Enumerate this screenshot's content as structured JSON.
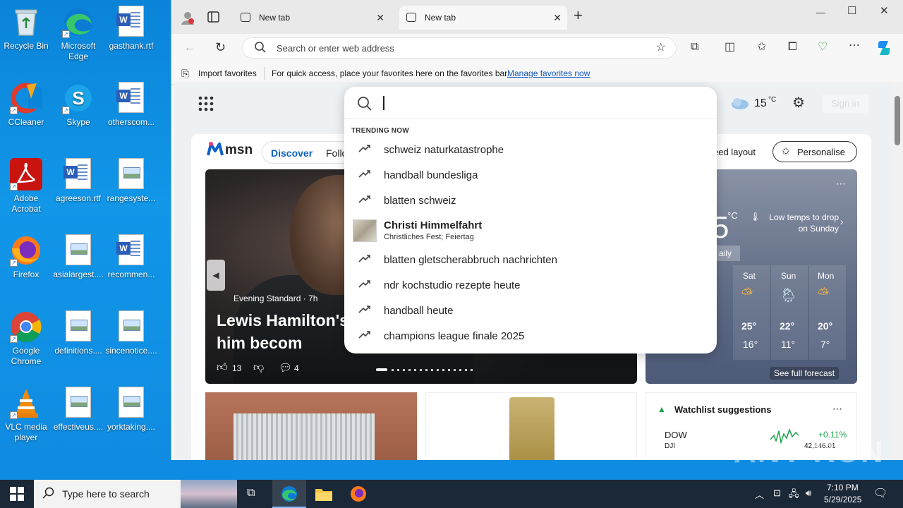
{
  "desktop": {
    "icons": [
      {
        "label": "Recycle Bin",
        "icon": "recycle-bin-icon"
      },
      {
        "label": "Microsoft Edge",
        "icon": "edge-icon"
      },
      {
        "label": "gasthank.rtf",
        "icon": "word-doc-icon"
      },
      {
        "label": "CCleaner",
        "icon": "ccleaner-icon"
      },
      {
        "label": "Skype",
        "icon": "skype-icon"
      },
      {
        "label": "otherscom...",
        "icon": "word-doc-icon"
      },
      {
        "label": "Adobe Acrobat",
        "icon": "acrobat-icon"
      },
      {
        "label": "agreeson.rtf",
        "icon": "word-doc-icon"
      },
      {
        "label": "rangesyste...",
        "icon": "image-file-icon"
      },
      {
        "label": "Firefox",
        "icon": "firefox-icon"
      },
      {
        "label": "asialargest....",
        "icon": "image-file-icon"
      },
      {
        "label": "recommen...",
        "icon": "word-doc-icon"
      },
      {
        "label": "Google Chrome",
        "icon": "chrome-icon"
      },
      {
        "label": "definitions....",
        "icon": "image-file-icon"
      },
      {
        "label": "sincenotice....",
        "icon": "image-file-icon"
      },
      {
        "label": "VLC media player",
        "icon": "vlc-icon"
      },
      {
        "label": "effectiveus....",
        "icon": "image-file-icon"
      },
      {
        "label": "yorktaking....",
        "icon": "image-file-icon"
      }
    ]
  },
  "browser": {
    "tabs": [
      {
        "label": "New tab",
        "close": "✕"
      },
      {
        "label": "New tab",
        "close": "✕"
      }
    ],
    "new_tab": "+",
    "window_controls": {
      "minimize": "—",
      "maximize": "☐",
      "close": "✕"
    },
    "address_placeholder": "Search or enter web address",
    "favorites_bar": {
      "import": "Import favorites",
      "hint": "For quick access, place your favorites here on the favorites bar.",
      "manage": "Manage favorites now"
    }
  },
  "msn": {
    "logo": "msn",
    "nav": {
      "discover": "Discover",
      "following": "Follo"
    },
    "feed_layout": "eed layout",
    "personalise": "Personalise",
    "weather_top": {
      "temp": "15",
      "unit": "°C"
    },
    "sign_in": "Sign in",
    "hero": {
      "source": "Evening Standard · 7h",
      "title": "Lewis Hamilton's helps him becom",
      "likes": "13",
      "comments": "4"
    },
    "weather": {
      "temp": "5",
      "unit": "°C",
      "alert": "Low temps to drop on Sunday",
      "tab": "aily",
      "days": [
        {
          "day": "Sat",
          "high": "25°",
          "low": "16°"
        },
        {
          "day": "Sun",
          "high": "22°",
          "low": "11°"
        },
        {
          "day": "Mon",
          "high": "20°",
          "low": "7°"
        }
      ],
      "forecast_link": "See full forecast"
    },
    "watchlist": {
      "title": "Watchlist suggestions",
      "symbol": "DOW",
      "sub": "DJI",
      "change": "+0.11%",
      "price": "42,146.01"
    }
  },
  "search_dropdown": {
    "heading": "TRENDING NOW",
    "suggestions": [
      {
        "text": "schweiz naturkatastrophe"
      },
      {
        "text": "handball bundesliga"
      },
      {
        "text": "blatten schweiz"
      },
      {
        "text": "Christi Himmelfahrt",
        "subtitle": "Christliches Fest; Feiertag",
        "rich": true
      },
      {
        "text": "blatten gletscherabbruch nachrichten"
      },
      {
        "text": "ndr kochstudio rezepte heute"
      },
      {
        "text": "handball heute"
      },
      {
        "text": "champions league finale 2025"
      }
    ]
  },
  "taskbar": {
    "search_placeholder": "Type here to search",
    "time": "7:10 PM",
    "date": "5/29/2025"
  },
  "watermark": "ANY RUN"
}
